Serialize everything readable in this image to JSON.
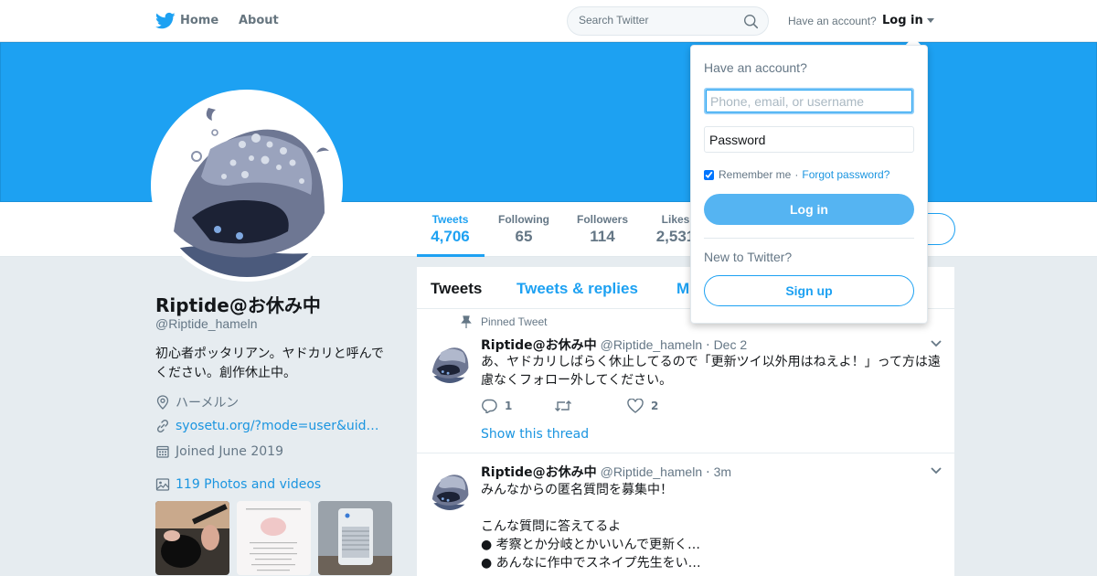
{
  "topbar": {
    "home_label": "Home",
    "about_label": "About",
    "search_placeholder": "Search Twitter",
    "account_prompt": "Have an account?",
    "login_label": "Log in"
  },
  "profile": {
    "name": "Riptide@お休み中",
    "handle": "@Riptide_hameln",
    "bio": "初心者ポッタリアン。ヤドカリと呼んでください。創作休止中。",
    "location": "ハーメルン",
    "url": "syosetu.org/?mode=user&uid…",
    "joined": "Joined June 2019",
    "photos_label": "119 Photos and videos"
  },
  "stats": [
    {
      "label": "Tweets",
      "value": "4,706"
    },
    {
      "label": "Following",
      "value": "65"
    },
    {
      "label": "Followers",
      "value": "114"
    },
    {
      "label": "Likes",
      "value": "2,531"
    }
  ],
  "timeline": {
    "tabs": [
      "Tweets",
      "Tweets & replies",
      "M"
    ],
    "pinned_label": "Pinned Tweet",
    "show_thread": "Show this thread",
    "tweets": [
      {
        "name": "Riptide@お休み中",
        "handle": "@Riptide_hameln",
        "sep": "·",
        "time": "Dec 2",
        "text": "あ、ヤドカリしばらく休止してるので「更新ツイ以外用はねえよ！」って方は遠慮なくフォロー外してください。",
        "replies": "1",
        "retweets": "",
        "likes": "2"
      },
      {
        "name": "Riptide@お休み中",
        "handle": "@Riptide_hameln",
        "sep": "·",
        "time": "3m",
        "text": "みんなからの匿名質問を募集中！\n\nこんな質問に答えてるよ\n● 考察とか分岐とかいいんで更新く…\n● あんなに作中でスネイプ先生をい…"
      }
    ]
  },
  "login_dropdown": {
    "title": "Have an account?",
    "username_placeholder": "Phone, email, or username",
    "password_label": "Password",
    "remember_label": "Remember me",
    "dot": "·",
    "forgot_label": "Forgot password?",
    "login_button": "Log in",
    "new_prompt": "New to Twitter?",
    "signup_button": "Sign up"
  },
  "colors": {
    "brand": "#1da1f2",
    "banner": "#1da1f2",
    "link": "#1b95e0"
  }
}
